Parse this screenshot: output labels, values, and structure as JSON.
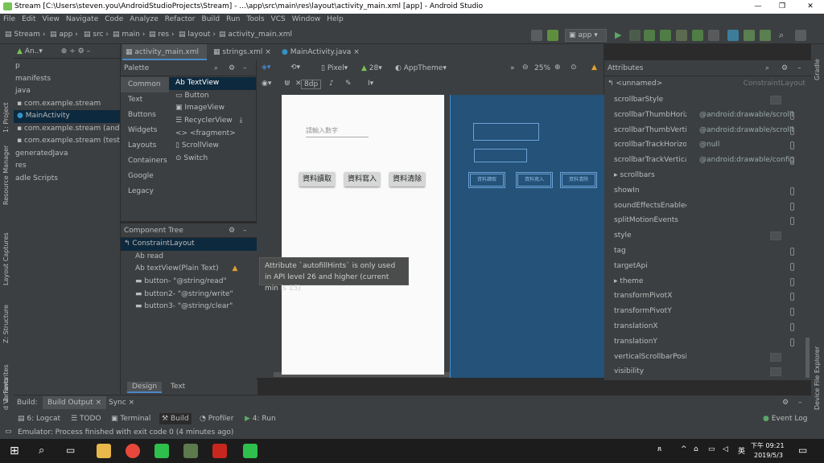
{
  "window": {
    "title": "Stream [C:\\Users\\steven.you\\AndroidStudioProjects\\Stream] - ...\\app\\src\\main\\res\\layout\\activity_main.xml [app] - Android Studio",
    "minimize": "—",
    "maximize": "❒",
    "close": "✕"
  },
  "menu": [
    "File",
    "Edit",
    "View",
    "Navigate",
    "Code",
    "Analyze",
    "Refactor",
    "Build",
    "Run",
    "Tools",
    "VCS",
    "Window",
    "Help"
  ],
  "breadcrumb": [
    "Stream",
    "app",
    "src",
    "main",
    "res",
    "layout",
    "activity_main.xml"
  ],
  "toolbar": {
    "config": "app"
  },
  "left_strip": {
    "project": "1: Project",
    "resource": "Resource Manager",
    "captures": "Layout Captures",
    "structure": "Z: Structure",
    "favorites": "2: Favorites",
    "variants": "d Variants"
  },
  "project": {
    "header": "An..▾",
    "items": [
      "p",
      "manifests",
      "java",
      "com.example.stream",
      "MainActivity",
      "com.example.stream (andro",
      "com.example.stream (test)",
      "generatedJava",
      "res",
      "adle Scripts"
    ]
  },
  "tabs": [
    "activity_main.xml",
    "strings.xml",
    "MainActivity.java"
  ],
  "palette": {
    "title": "Palette",
    "categories": [
      "Common",
      "Text",
      "Buttons",
      "Widgets",
      "Layouts",
      "Containers",
      "Google",
      "Legacy"
    ],
    "items": [
      "Ab TextView",
      "Button",
      "ImageView",
      "RecyclerView",
      "<fragment>",
      "ScrollView",
      "Switch"
    ]
  },
  "component_tree": {
    "title": "Component Tree",
    "rows": [
      "ConstraintLayout",
      "Ab read",
      "Ab textView(Plain Text)",
      "button- \"@string/read\"",
      "button2- \"@string/write\"",
      "button3- \"@string/clear\""
    ]
  },
  "design_toolbar": {
    "device": "Pixel▾",
    "api": "28▾",
    "theme": "AppTheme▾",
    "zoom": "25%",
    "margin": "8dp"
  },
  "phone": {
    "hint": "請輸入數字",
    "buttons": [
      "資料讀取",
      "資料寫入",
      "資料清除"
    ],
    "bp_buttons": [
      "資料讀取",
      "資料寫入",
      "資料清除"
    ]
  },
  "tooltip": "Attribute `autofillHints` is only used in API level 26 and higher (current min is 15)",
  "attributes": {
    "title": "Attributes",
    "component": "<unnamed>",
    "type": "ConstraintLayout",
    "rows": [
      {
        "name": "scrollbarStyle",
        "value": ""
      },
      {
        "name": "scrollbarThumbHorizo",
        "value": "@android:drawable/scrollb"
      },
      {
        "name": "scrollbarThumbVertica",
        "value": "@android:drawable/scrollb"
      },
      {
        "name": "scrollbarTrackHorizont",
        "value": "@null"
      },
      {
        "name": "scrollbarTrackVertical",
        "value": "@android:drawable/config"
      },
      {
        "name": "▸ scrollbars",
        "value": ""
      },
      {
        "name": "showIn",
        "value": ""
      },
      {
        "name": "soundEffectsEnabled",
        "value": ""
      },
      {
        "name": "splitMotionEvents",
        "value": ""
      },
      {
        "name": "style",
        "value": ""
      },
      {
        "name": "tag",
        "value": ""
      },
      {
        "name": "targetApi",
        "value": ""
      },
      {
        "name": "▸ theme",
        "value": ""
      },
      {
        "name": "transformPivotX",
        "value": ""
      },
      {
        "name": "transformPivotY",
        "value": ""
      },
      {
        "name": "translationX",
        "value": ""
      },
      {
        "name": "translationY",
        "value": ""
      },
      {
        "name": "verticalScrollbarPositic",
        "value": ""
      },
      {
        "name": "visibility",
        "value": ""
      }
    ]
  },
  "right_strip": {
    "gradle": "Gradle",
    "device": "Device File Explorer"
  },
  "design_tabs": [
    "Design",
    "Text"
  ],
  "build": {
    "label": "Build:",
    "tabs": [
      "Build Output",
      "Sync"
    ]
  },
  "bottom_tools": [
    "6: Logcat",
    "TODO",
    "Terminal",
    "Build",
    "Profiler",
    "4: Run"
  ],
  "event_log": "Event Log",
  "status": "Emulator: Process finished with exit code 0 (4 minutes ago)",
  "taskbar": {
    "time": "下午 09:21",
    "date": "2019/5/3",
    "ime": "英"
  }
}
